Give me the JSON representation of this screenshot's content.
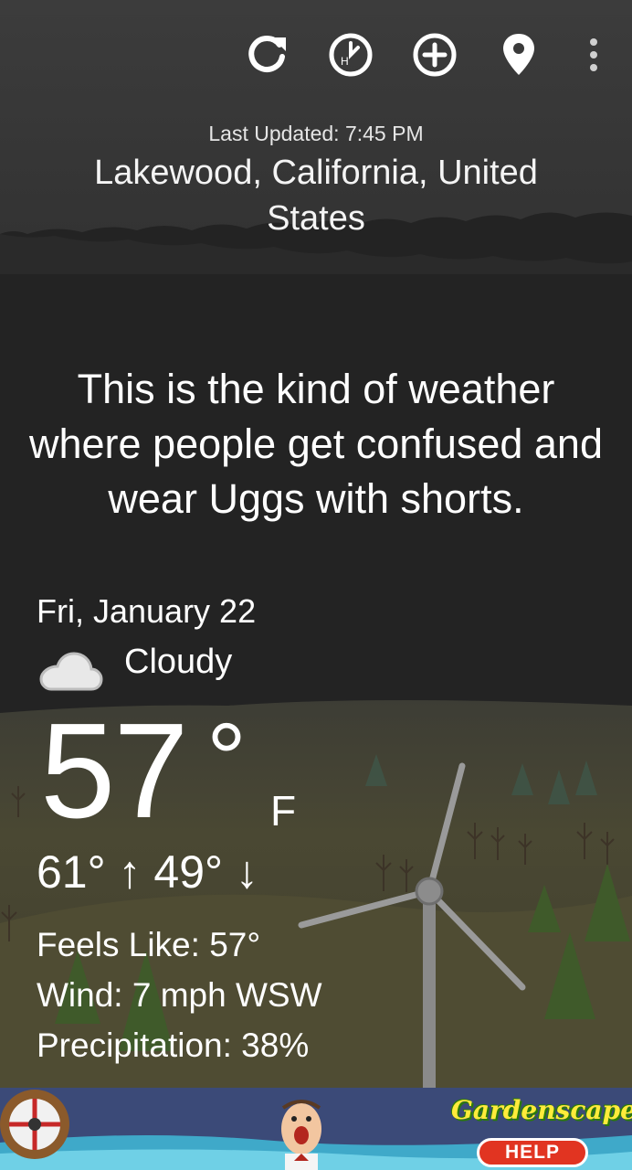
{
  "toolbar": {
    "icons": [
      "refresh-icon",
      "hourly-clock-icon",
      "add-location-icon",
      "location-pin-icon",
      "more-vert-icon"
    ],
    "hourly_letter": "H"
  },
  "header": {
    "last_updated": "Last Updated: 7:45 PM",
    "location": "Lakewood, California, United States"
  },
  "quote": "This is the kind of weather where people get confused and wear Uggs with shorts.",
  "current": {
    "date": "Fri, January 22",
    "condition": "Cloudy",
    "condition_icon": "cloud-icon",
    "temperature": "57",
    "degree": "°",
    "unit": "F",
    "hi_lo": "61° ↑ 49° ↓",
    "details": [
      "Feels Like: 57°",
      "Wind: 7 mph WSW",
      "Precipitation: 38%"
    ]
  },
  "ad": {
    "logo": "Gardenscapes",
    "help_label": "HELP"
  },
  "colors": {
    "sky_top": "#3a3a3a",
    "sky": "#232323",
    "hills": "#4d4a30",
    "ad_accent": "#e13421"
  }
}
